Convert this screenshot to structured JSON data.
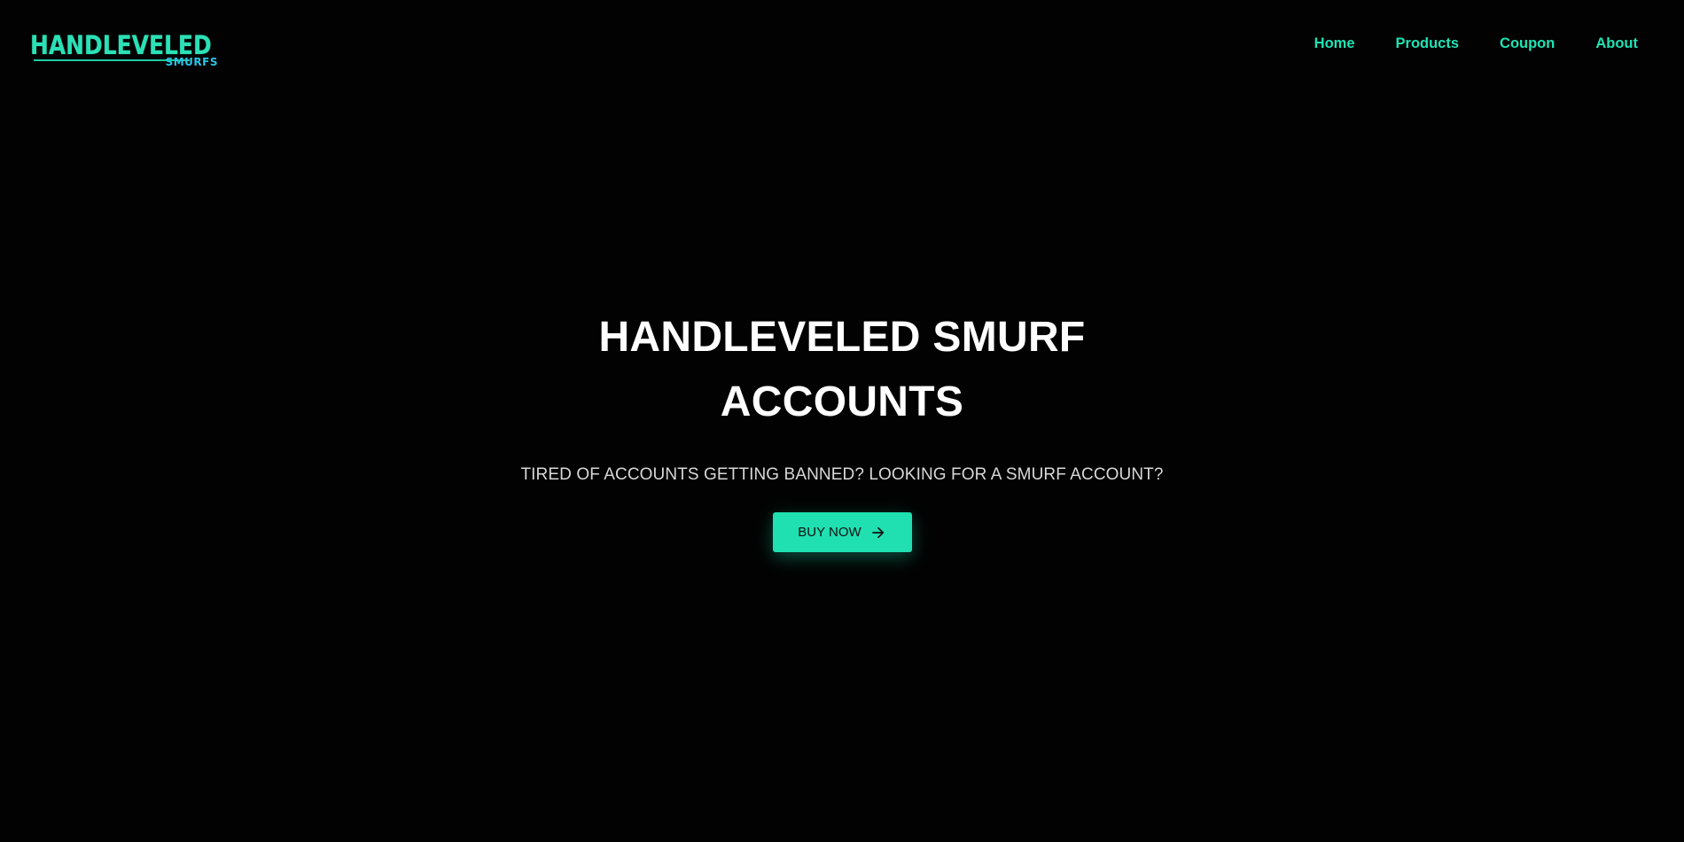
{
  "header": {
    "logo": {
      "main": "HANDLEVELED",
      "sub": "SMURFS"
    },
    "nav": [
      {
        "label": "Home"
      },
      {
        "label": "Products"
      },
      {
        "label": "Coupon"
      },
      {
        "label": "About"
      }
    ]
  },
  "hero": {
    "title": "HANDLEVELED SMURF ACCOUNTS",
    "subtitle": "TIRED OF ACCOUNTS GETTING BANNED? LOOKING FOR A SMURF ACCOUNT?",
    "cta_label": "BUY NOW",
    "cta_icon": "arrow-right-icon"
  },
  "colors": {
    "background": "#020202",
    "accent": "#20dfb0",
    "logo_sub": "#2ac4e6",
    "title": "#ffffff",
    "subtitle": "#d8d8d8"
  }
}
